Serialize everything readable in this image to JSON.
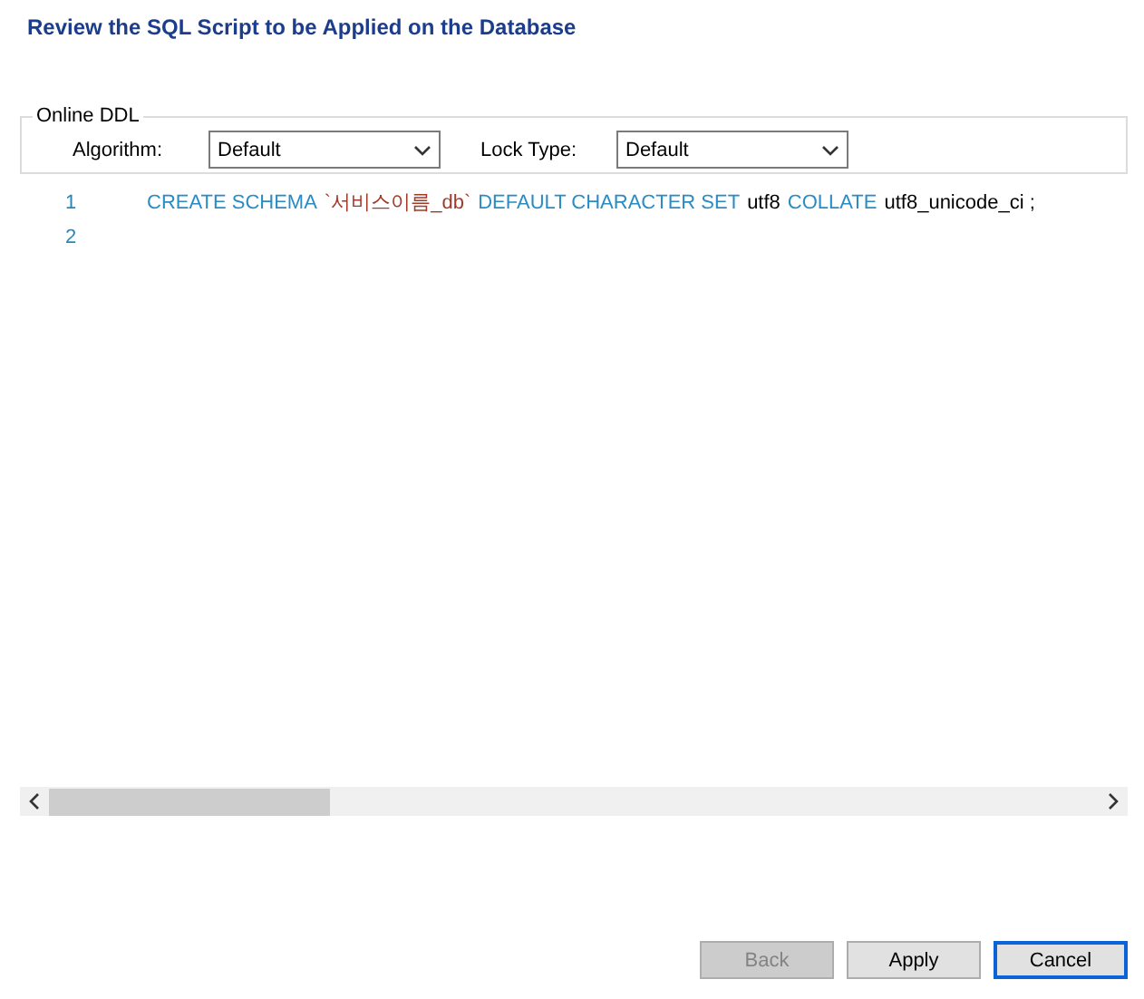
{
  "title": "Review the SQL Script to be Applied on the Database",
  "online_ddl": {
    "legend": "Online DDL",
    "fields": [
      {
        "label": "Algorithm:",
        "value": "Default"
      },
      {
        "label": "Lock Type:",
        "value": "Default"
      }
    ]
  },
  "editor": {
    "lines": [
      {
        "number": "1",
        "tokens": [
          {
            "kind": "keyword",
            "text": "CREATE SCHEMA"
          },
          {
            "kind": "string",
            "text": "`서비스이름_db`"
          },
          {
            "kind": "keyword",
            "text": "DEFAULT CHARACTER SET"
          },
          {
            "kind": "plain",
            "text": "utf8"
          },
          {
            "kind": "keyword",
            "text": "COLLATE"
          },
          {
            "kind": "plain",
            "text": "utf8_unicode_ci ;"
          }
        ]
      },
      {
        "number": "2"
      }
    ]
  },
  "buttons": [
    {
      "label": "Back",
      "disabled": true,
      "focused": false
    },
    {
      "label": "Apply",
      "disabled": false,
      "focused": false
    },
    {
      "label": "Cancel",
      "disabled": false,
      "focused": true
    }
  ]
}
